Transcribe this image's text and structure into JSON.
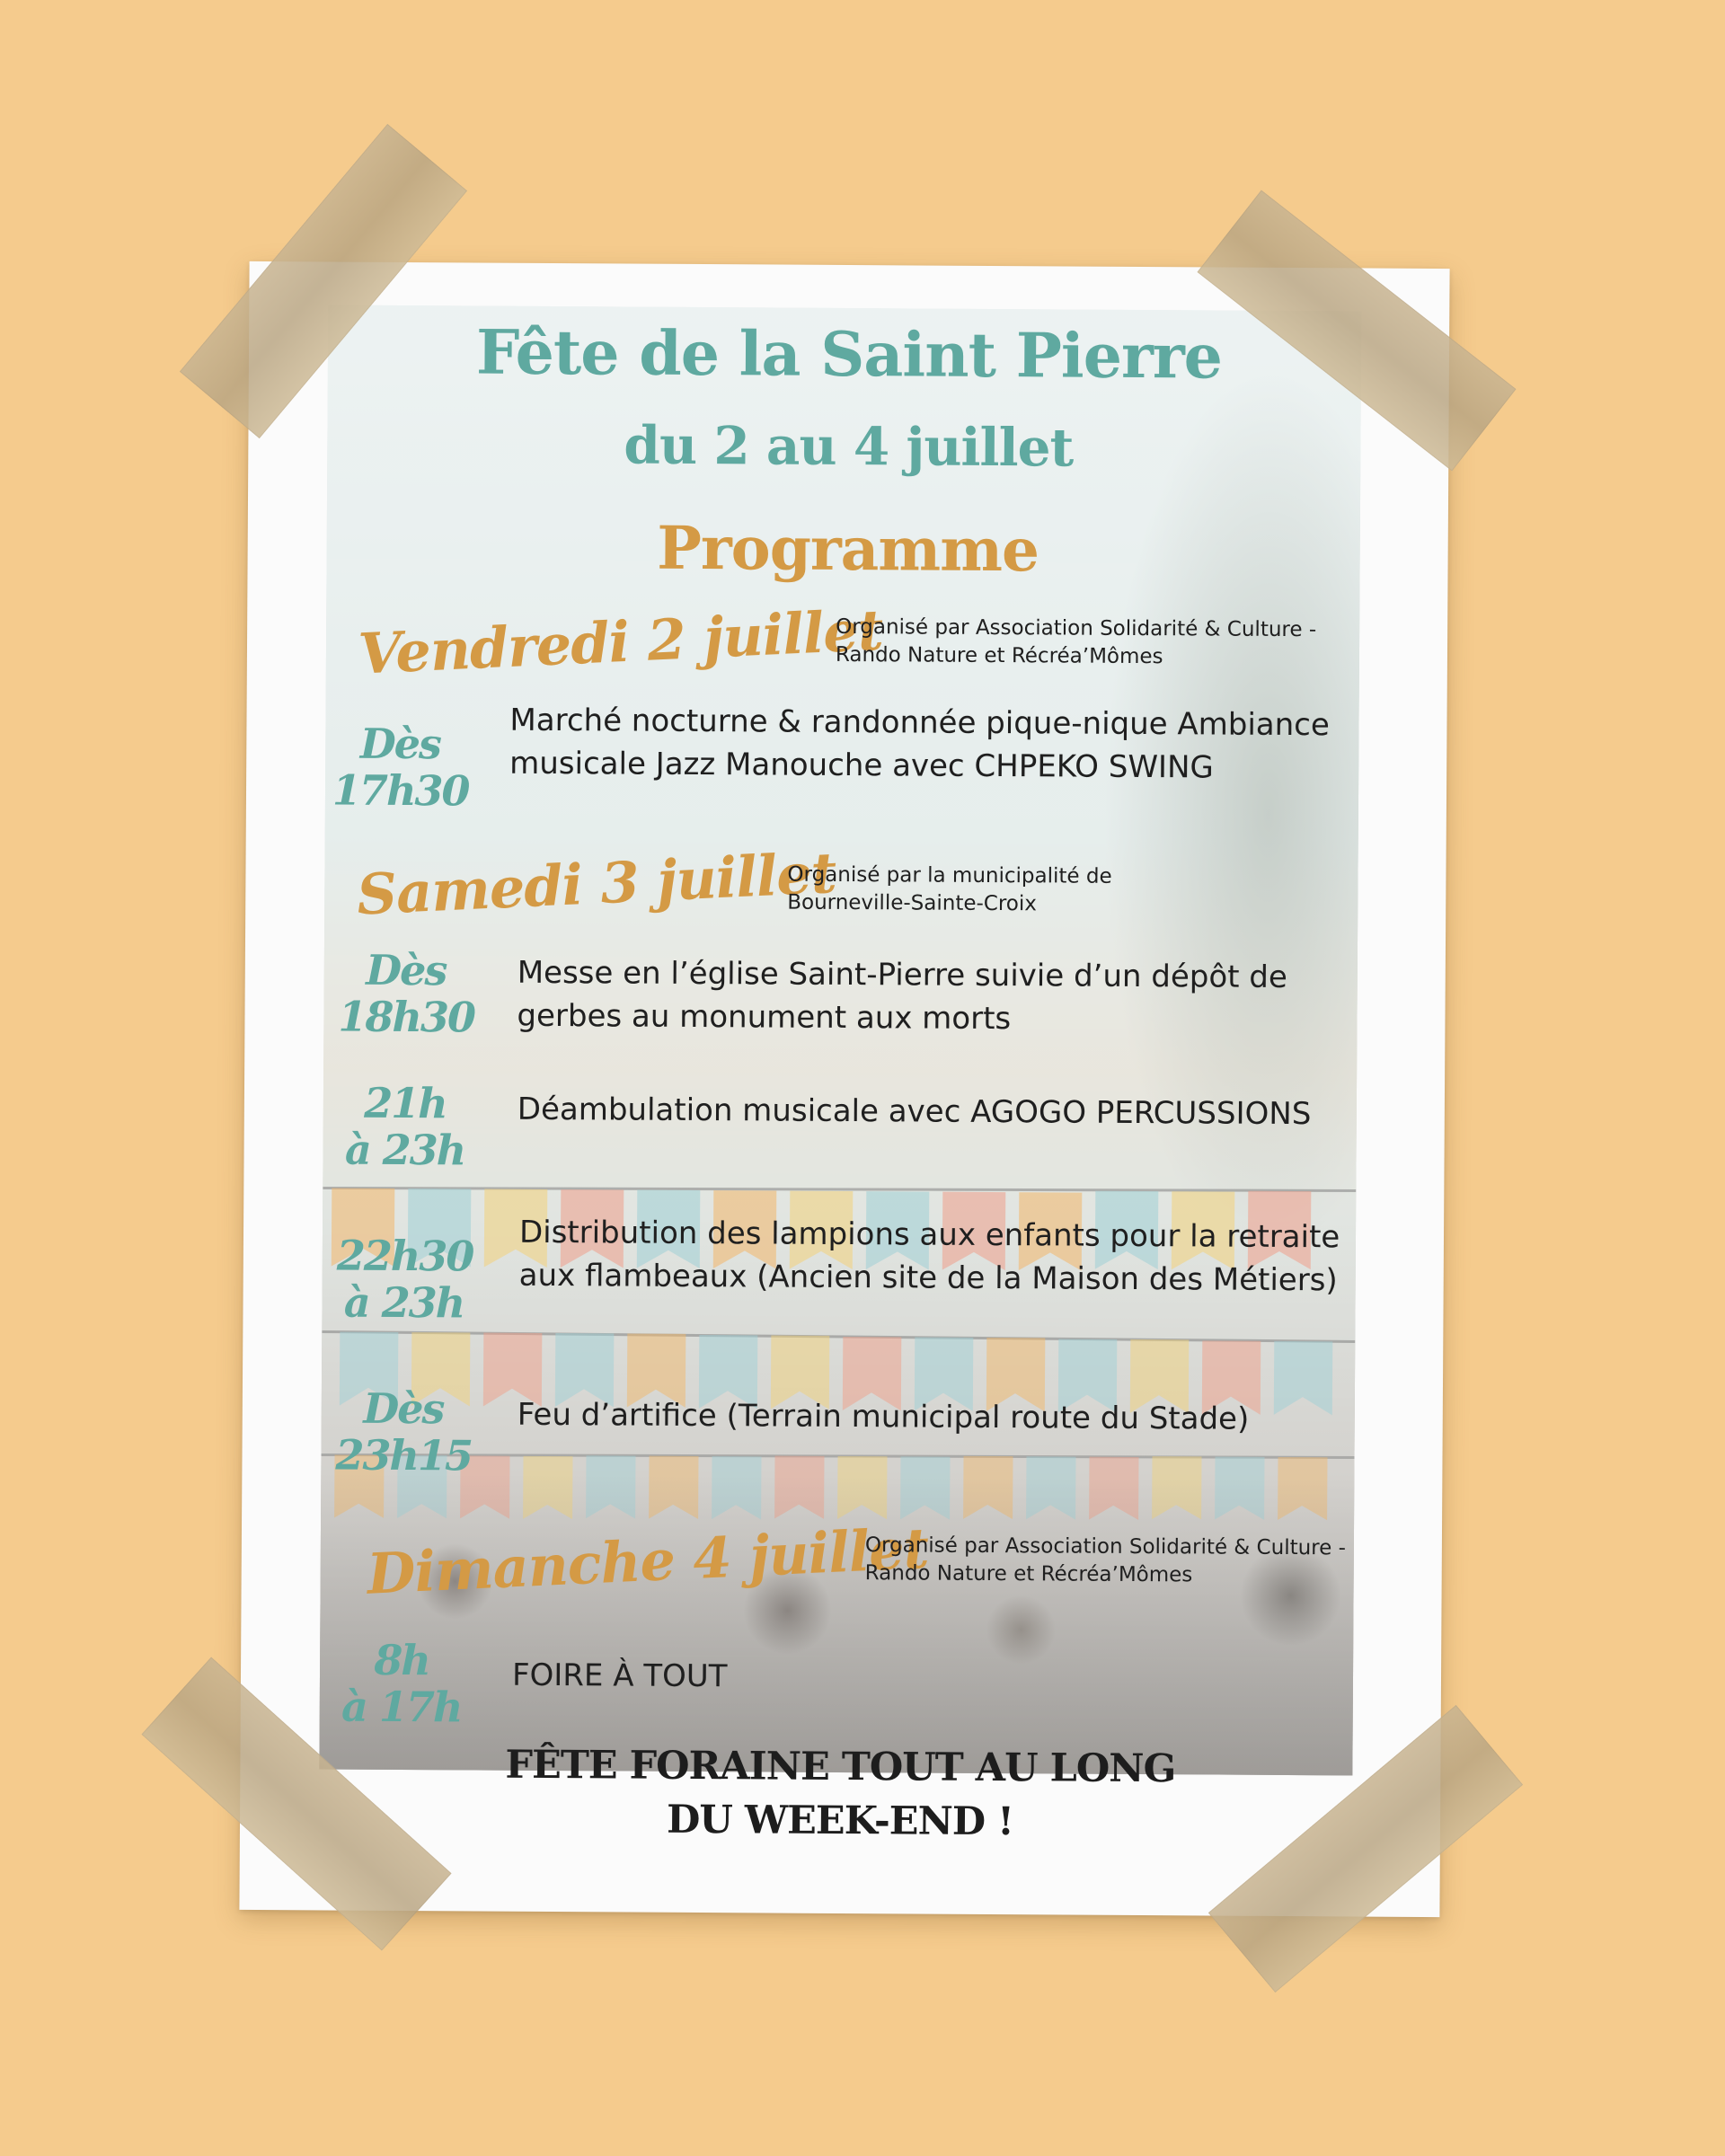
{
  "poster": {
    "title": "Fête de la Saint Pierre",
    "dates": "du 2 au 4 juillet",
    "programme_label": "Programme"
  },
  "days": [
    {
      "day": "Vendredi 2 juillet",
      "organizer": "Organisé par Association Solidarité & Culture - Rando Nature et Récréa’Mômes",
      "events": [
        {
          "time_line1": "Dès",
          "time_line2": "17h30",
          "description": "Marché nocturne & randonnée pique-nique Ambiance musicale Jazz Manouche avec CHPEKO SWING"
        }
      ]
    },
    {
      "day": "Samedi 3 juillet",
      "organizer": "Organisé par la municipalité de Bourneville-Sainte-Croix",
      "events": [
        {
          "time_line1": "Dès",
          "time_line2": "18h30",
          "description": "Messe en l’église Saint-Pierre suivie d’un dépôt de gerbes au monument aux morts"
        },
        {
          "time_line1": "21h",
          "time_line2": "à 23h",
          "description": "Déambulation musicale avec AGOGO PERCUSSIONS"
        },
        {
          "time_line1": "22h30",
          "time_line2": "à 23h",
          "description": "Distribution des lampions aux enfants pour la retraite aux flambeaux (Ancien site de la Maison des Métiers)"
        },
        {
          "time_line1": "Dès",
          "time_line2": "23h15",
          "description": "Feu d’artifice (Terrain municipal route du Stade)"
        }
      ]
    },
    {
      "day": "Dimanche 4 juillet",
      "organizer": "Organisé par Association Solidarité & Culture - Rando Nature et Récréa’Mômes",
      "events": [
        {
          "time_line1": "8h",
          "time_line2": "à 17h",
          "description": "FOIRE À TOUT"
        }
      ]
    }
  ],
  "footer": {
    "line1": "FÊTE FORAINE TOUT AU LONG",
    "line2": "DU WEEK-END !"
  },
  "colors": {
    "background": "#f5cb8d",
    "teal": "#5fa9a0",
    "ochre": "#d49a45",
    "text": "#1f1f1f"
  }
}
